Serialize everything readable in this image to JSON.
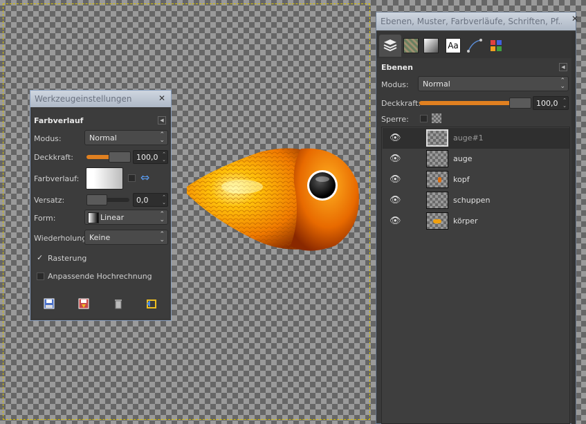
{
  "tool_options": {
    "title": "Werkzeugeinstellungen",
    "tool_name": "Farbverlauf",
    "mode_label": "Modus:",
    "mode_value": "Normal",
    "opacity_label": "Deckkraft:",
    "opacity_value": "100,0",
    "gradient_label": "Farbverlauf:",
    "offset_label": "Versatz:",
    "offset_value": "0,0",
    "shape_label": "Form:",
    "shape_value": "Linear",
    "repeat_label": "Wiederholung:",
    "repeat_value": "Keine",
    "dithering_label": "Rasterung",
    "dithering_checked": true,
    "adaptive_label": "Anpassende Hochrechnung",
    "adaptive_checked": false
  },
  "layers_panel": {
    "title": "Ebenen, Muster, Farbverläufe, Schriften, Pf...",
    "heading": "Ebenen",
    "mode_label": "Modus:",
    "mode_value": "Normal",
    "opacity_label": "Deckkraft:",
    "opacity_value": "100,0",
    "lock_label": "Sperre:",
    "tabs": [
      "layers",
      "patterns",
      "gradients",
      "fonts",
      "paths",
      "colors"
    ],
    "font_tab_label": "Aa",
    "layers": [
      {
        "name": "auge#1",
        "selected": true
      },
      {
        "name": "auge",
        "selected": false
      },
      {
        "name": "kopf",
        "selected": false
      },
      {
        "name": "schuppen",
        "selected": false
      },
      {
        "name": "körper",
        "selected": false
      }
    ]
  },
  "colors": {
    "accent": "#e08020",
    "panel_bg": "#3a3a3a"
  }
}
